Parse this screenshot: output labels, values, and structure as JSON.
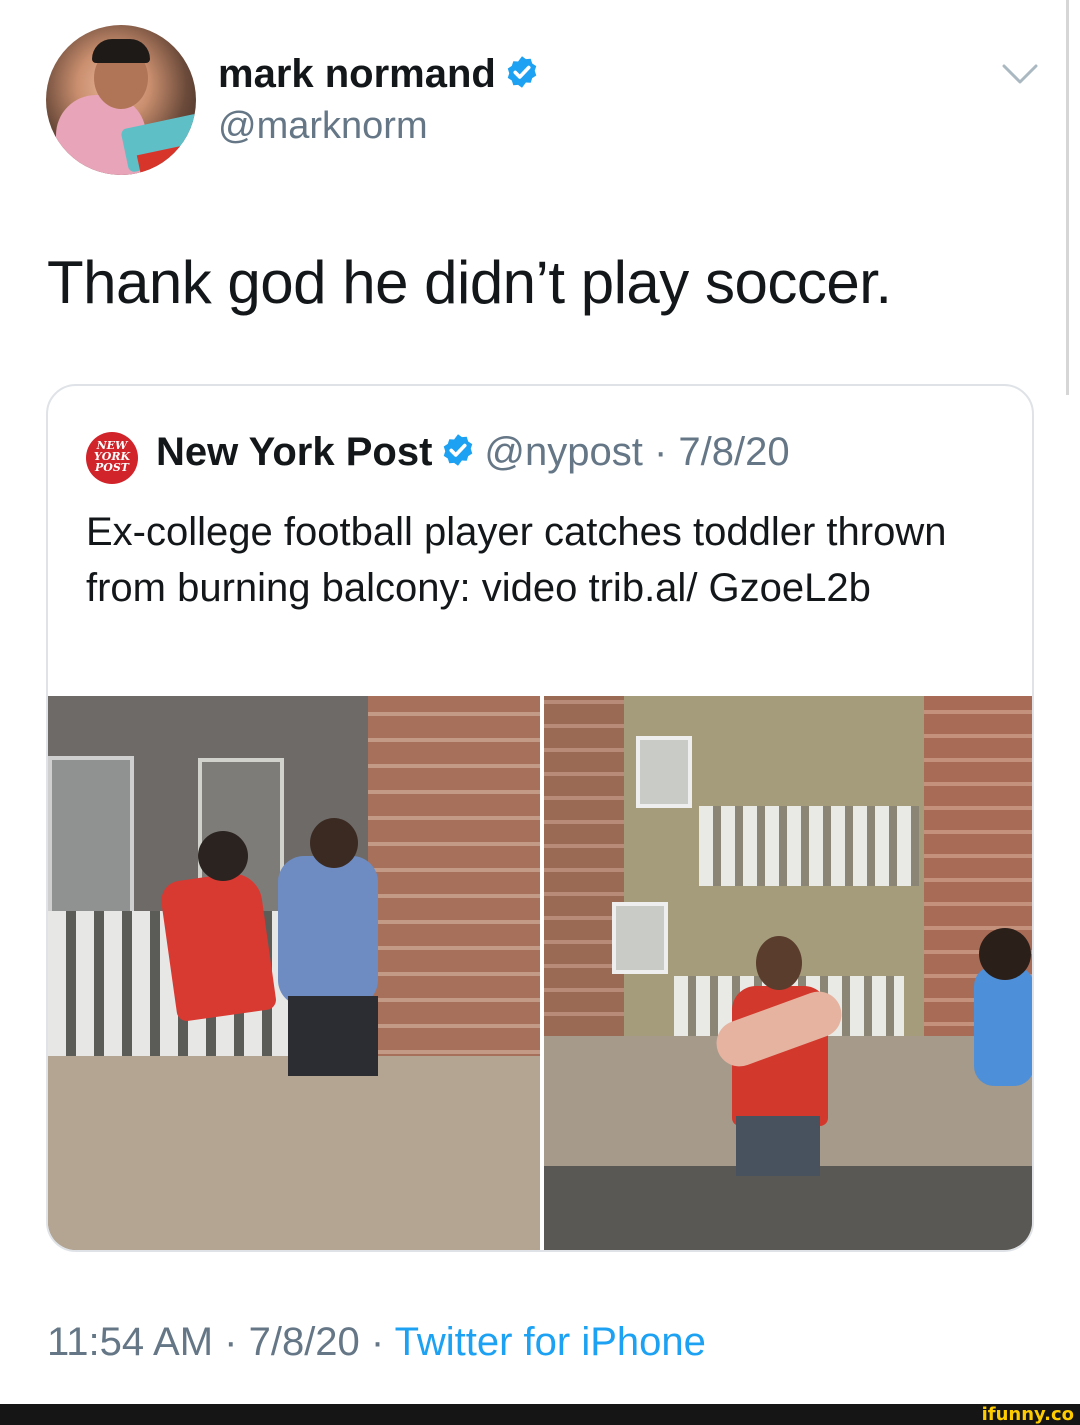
{
  "tweet": {
    "author": {
      "name": "mark normand",
      "handle": "@marknorm",
      "verified": true
    },
    "text": "Thank god he didn’t play soccer.",
    "quoted": {
      "author_name": "New York Post",
      "logo_lines": [
        "NEW",
        "YORK",
        "POST"
      ],
      "meta": "@nypost · 7/8/20",
      "verified": true,
      "text": "Ex-college football player catches toddler thrown from burning balcony: video trib.al/ GzoeL2b"
    },
    "footer": {
      "time_date": "11:54 AM · 7/8/20 · ",
      "source": "Twitter for iPhone"
    }
  },
  "watermark": "ifunny.co",
  "colors": {
    "verified_blue": "#1da1f2",
    "secondary_text": "#657786",
    "ifunny_yellow": "#ffcc00"
  }
}
